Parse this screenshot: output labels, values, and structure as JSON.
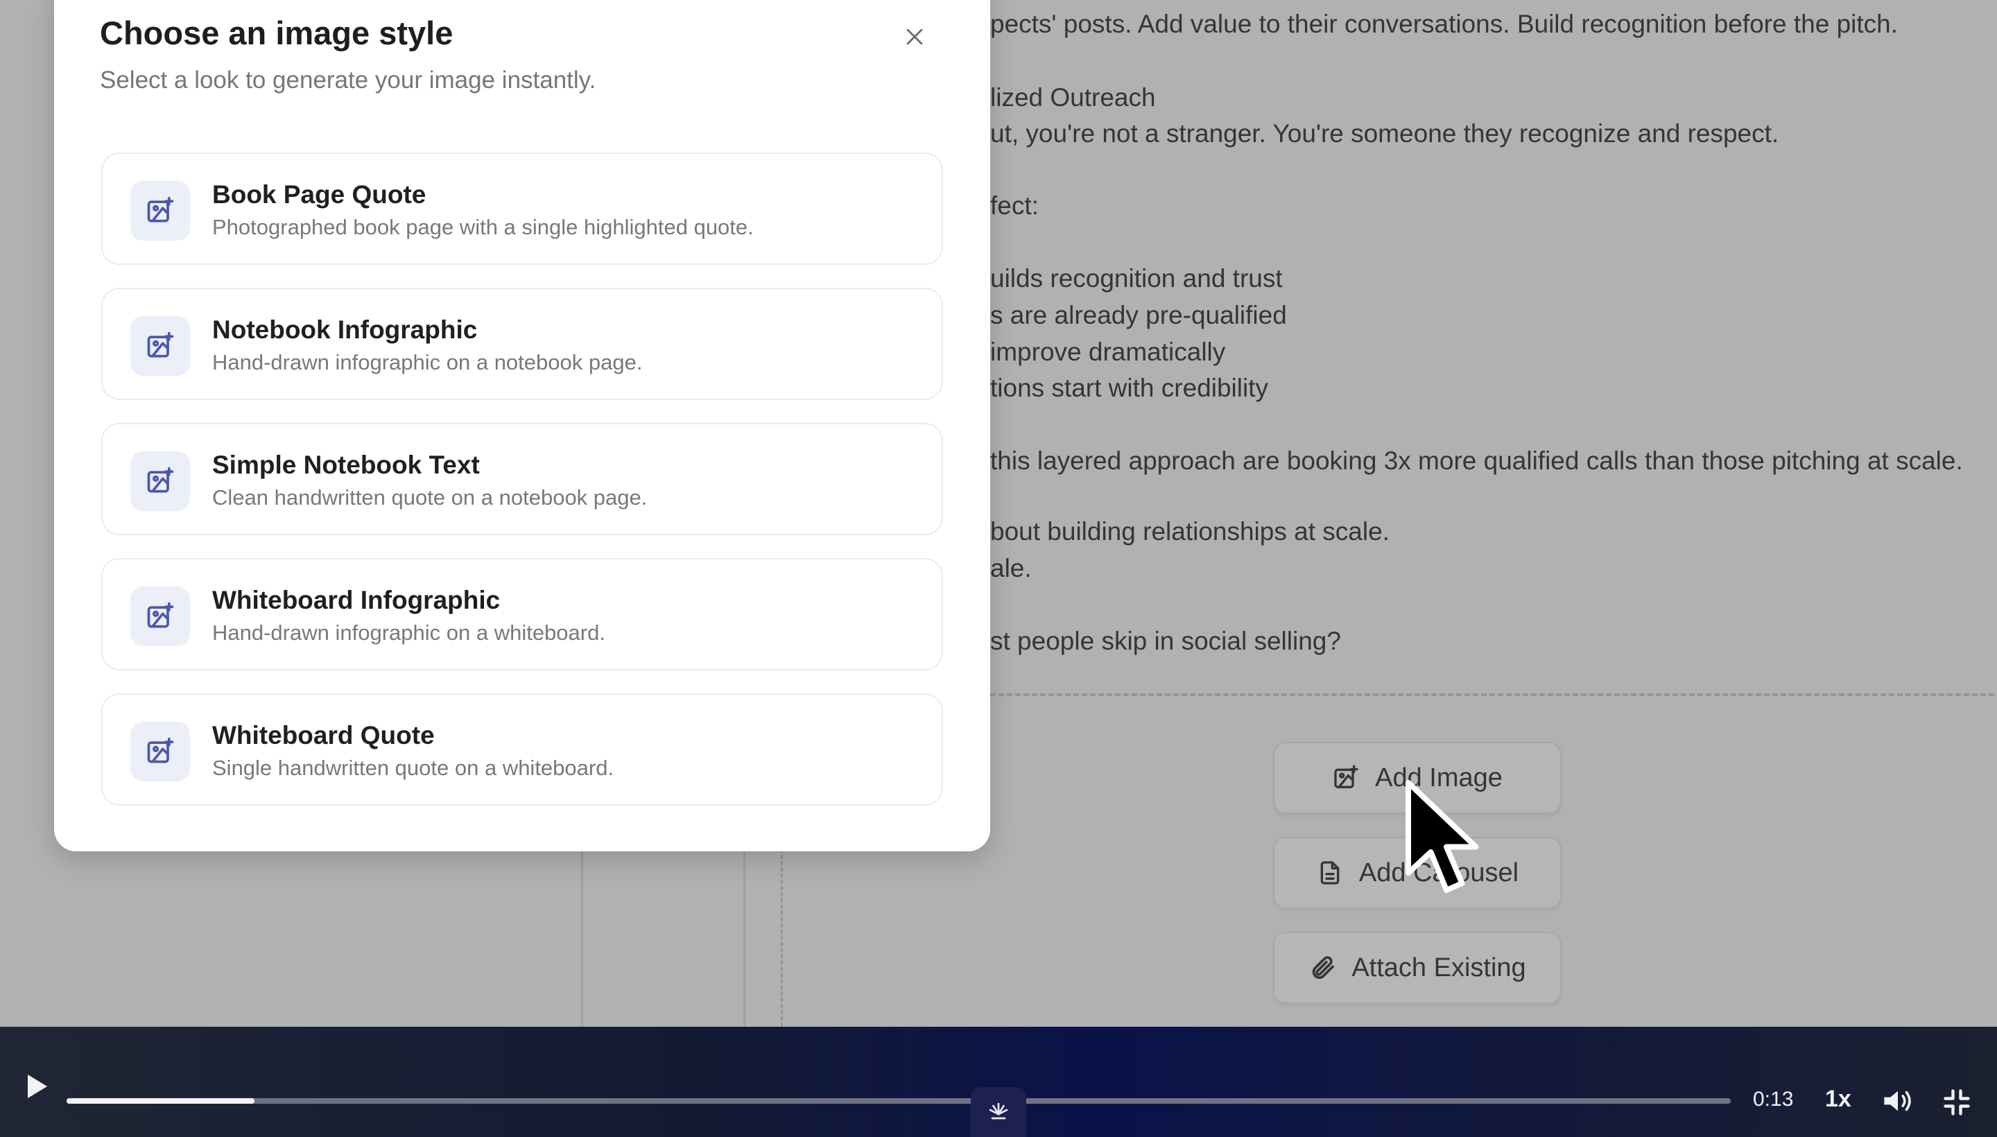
{
  "background": {
    "post_lines": [
      "pects' posts. Add value to their conversations. Build recognition before the pitch.",
      "lized Outreach",
      "ut, you're not a stranger. You're someone they recognize and respect.",
      "fect:",
      "uilds recognition and trust",
      "s are already pre-qualified",
      " improve dramatically",
      "tions start with credibility",
      "this layered approach are booking 3x more qualified calls than those pitching at scale.",
      "bout building relationships at scale.",
      "ale.",
      "st people skip in social selling?"
    ],
    "buttons": {
      "add_image": "Add Image",
      "add_carousel": "Add Carousel",
      "attach_existing": "Attach Existing"
    }
  },
  "modal": {
    "title": "Choose an image style",
    "subtitle": "Select a look to generate your image instantly.",
    "options": [
      {
        "title": "Book Page Quote",
        "desc": "Photographed book page with a single highlighted quote."
      },
      {
        "title": "Notebook Infographic",
        "desc": "Hand-drawn infographic on a notebook page."
      },
      {
        "title": "Simple Notebook Text",
        "desc": "Clean handwritten quote on a notebook page."
      },
      {
        "title": "Whiteboard Infographic",
        "desc": "Hand-drawn infographic on a whiteboard."
      },
      {
        "title": "Whiteboard Quote",
        "desc": "Single handwritten quote on a whiteboard."
      }
    ]
  },
  "player": {
    "time": "0:13",
    "speed": "1x",
    "progress": 0.113
  },
  "icons": {
    "close": "close-icon",
    "option": "image-sparkle-icon",
    "play": "play-icon",
    "volume": "volume-icon",
    "fullscreen_exit": "fullscreen-exit-icon"
  }
}
